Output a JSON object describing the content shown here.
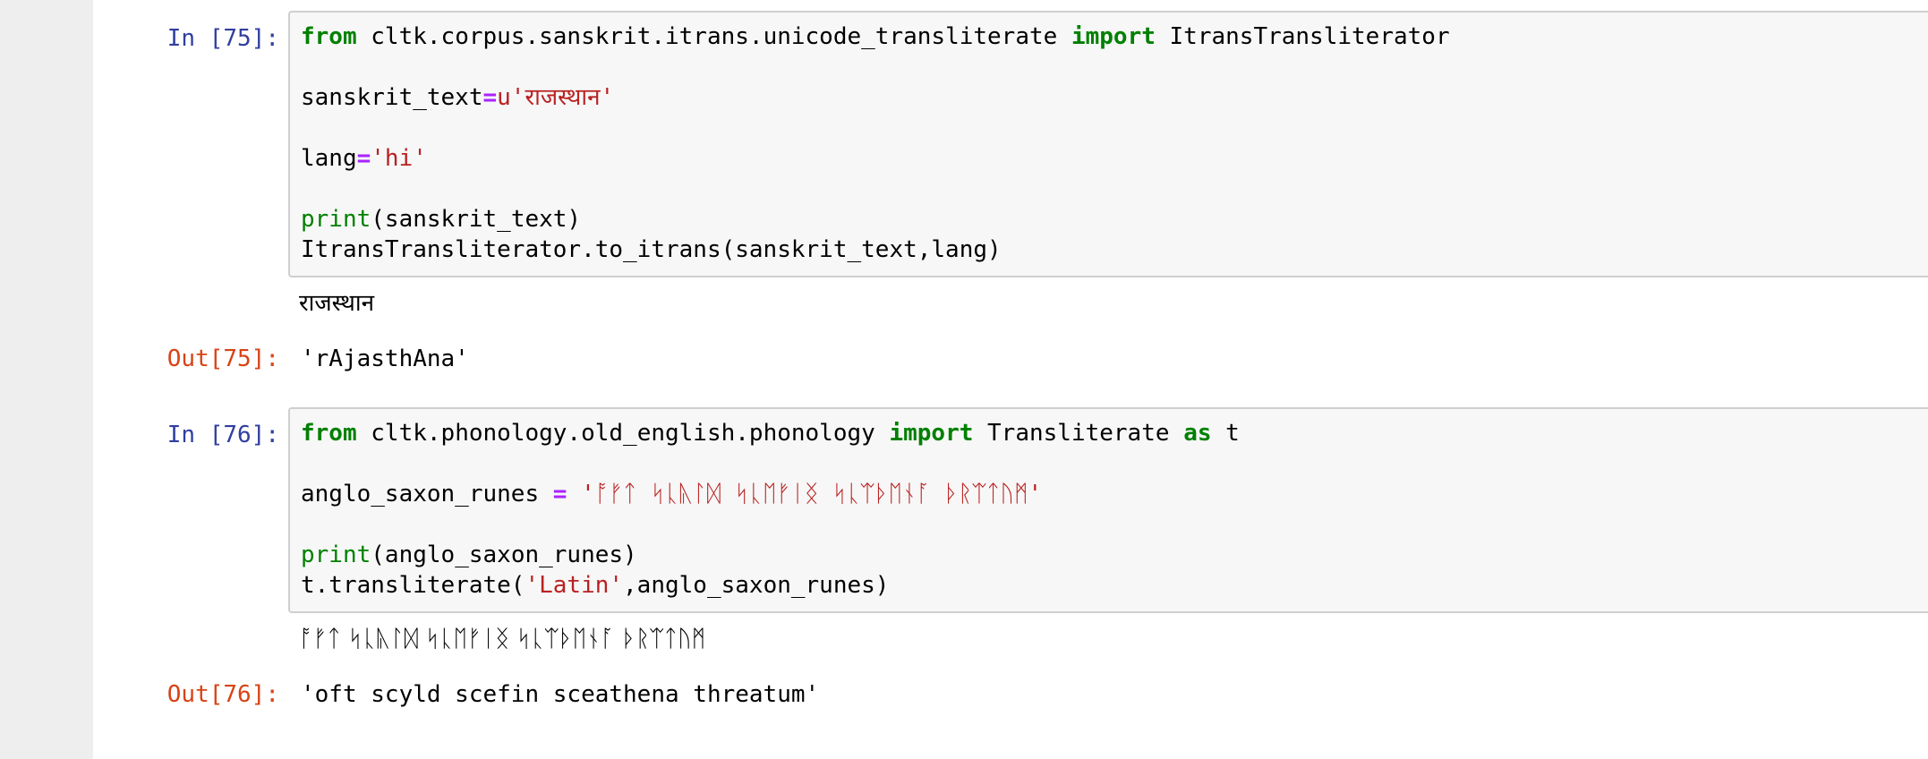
{
  "cells": [
    {
      "in_prompt": "In [75]:",
      "code": {
        "l1_kw_from": "from",
        "l1_module": " cltk.corpus.sanskrit.itrans.unicode_transliterate ",
        "l1_kw_import": "import",
        "l1_name": " ItransTransliterator",
        "l3_var": "sanskrit_text",
        "l3_eq": "=",
        "l3_str": "u'राजस्थान'",
        "l5_var": "lang",
        "l5_eq": "=",
        "l5_str": "'hi'",
        "l7_print": "print",
        "l7_args": "(sanskrit_text)",
        "l8_call": "ItransTransliterator.to_itrans(sanskrit_text,lang)"
      },
      "stdout": "राजस्थान",
      "out_prompt": "Out[75]:",
      "result": "'rAjasthAna'"
    },
    {
      "in_prompt": "In [76]:",
      "code": {
        "l1_kw_from": "from",
        "l1_module": " cltk.phonology.old_english.phonology ",
        "l1_kw_import": "import",
        "l1_name": " Transliterate ",
        "l1_kw_as": "as",
        "l1_alias": " t",
        "l3_var": "anglo_saxon_runes ",
        "l3_eq": "=",
        "l3_str": " 'ᚩᚠᛏ ᛋᚳᚣᛚᛞ ᛋᚳᛖᚠᛁᛝ ᛋᚳᛠᚦᛖᚾᚪ ᚦᚱᛠᛏᚢᛗ'",
        "l5_print": "print",
        "l5_args": "(anglo_saxon_runes)",
        "l6_pre": "t.transliterate(",
        "l6_str": "'Latin'",
        "l6_post": ",anglo_saxon_runes)"
      },
      "stdout": "ᚩᚠᛏ ᛋᚳᚣᛚᛞ ᛋᚳᛖᚠᛁᛝ ᛋᚳᛠᚦᛖᚾᚪ ᚦᚱᛠᛏᚢᛗ",
      "out_prompt": "Out[76]:",
      "result": "'oft scyld scefin sceathena threatum'"
    }
  ]
}
